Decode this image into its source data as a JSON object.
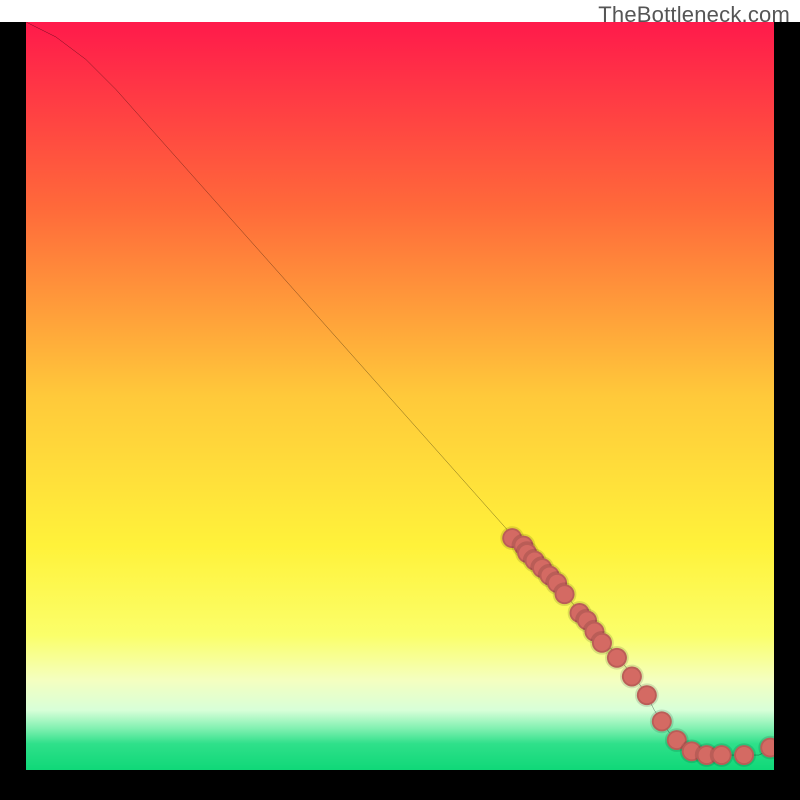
{
  "watermark": "TheBottleneck.com",
  "chart_data": {
    "type": "line",
    "title": "",
    "xlabel": "",
    "ylabel": "",
    "xlim": [
      0,
      100
    ],
    "ylim": [
      0,
      100
    ],
    "curve": {
      "name": "bottleneck-curve",
      "x": [
        0,
        4,
        8,
        12,
        16,
        20,
        24,
        28,
        32,
        36,
        40,
        44,
        48,
        52,
        56,
        60,
        64,
        68,
        72,
        76,
        78,
        80,
        82,
        83,
        84,
        86,
        88,
        90,
        92,
        94,
        96,
        98,
        100
      ],
      "y": [
        100,
        98,
        95,
        91,
        86.5,
        82,
        77.5,
        73,
        68.5,
        64,
        59.5,
        55,
        50.5,
        46,
        41.5,
        37,
        32.5,
        28,
        23.5,
        19,
        16.5,
        14,
        11.5,
        10,
        8,
        5,
        3,
        2,
        2,
        2,
        2,
        2,
        3
      ]
    },
    "markers": {
      "name": "highlighted-points",
      "x": [
        65,
        66.5,
        67,
        68,
        69,
        70,
        71,
        72,
        74,
        75,
        76,
        77,
        79,
        81,
        83,
        85,
        87,
        89,
        91,
        93,
        96,
        99.5
      ],
      "y": [
        31,
        30,
        29,
        28,
        27,
        26,
        25,
        23.5,
        21,
        20,
        18.5,
        17,
        15,
        12.5,
        10,
        6.5,
        4,
        2.5,
        2,
        2,
        2,
        3
      ]
    },
    "gradient_stops": [
      {
        "offset": 0.0,
        "color": "#ff1a4b"
      },
      {
        "offset": 0.25,
        "color": "#ff6a3a"
      },
      {
        "offset": 0.5,
        "color": "#ffc93a"
      },
      {
        "offset": 0.7,
        "color": "#fff23a"
      },
      {
        "offset": 0.82,
        "color": "#fbff6a"
      },
      {
        "offset": 0.88,
        "color": "#f4ffc0"
      },
      {
        "offset": 0.92,
        "color": "#d8ffd8"
      },
      {
        "offset": 0.945,
        "color": "#7ff0b0"
      },
      {
        "offset": 0.965,
        "color": "#2fe08a"
      },
      {
        "offset": 1.0,
        "color": "#0fd878"
      }
    ]
  }
}
